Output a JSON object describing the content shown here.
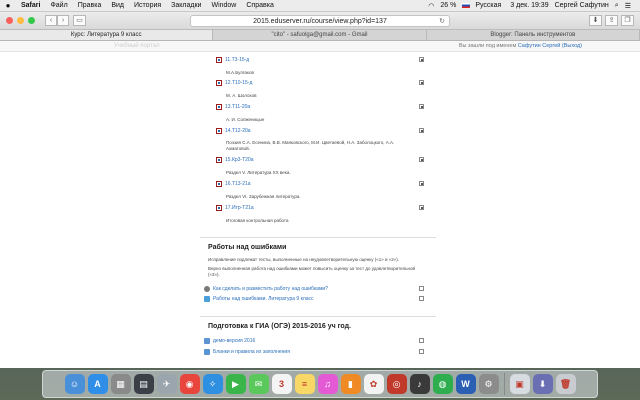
{
  "menubar": {
    "items": [
      "Safari",
      "Файл",
      "Правка",
      "Вид",
      "История",
      "Закладки",
      "Window",
      "Справка"
    ],
    "battery": "26 %",
    "language": "Русская",
    "datetime": "3 дек.  19:39",
    "user": "Сергей Сафутин"
  },
  "browser": {
    "url": "2015.eduserver.ru/course/view.php?id=137",
    "tabs": [
      "Курс: Литература 9 класс",
      "\"cito\" - safuolga@gmail.com - Gmail",
      "Blogger: Панель инструментов"
    ],
    "active_tab": 0
  },
  "site": {
    "brand": "Учебный портал",
    "login_prefix": "Вы зашли под именем",
    "login_user": "Сафутин Сергей",
    "logout": "(Выход)"
  },
  "course_items": [
    {
      "link": "11.Т3-15-д",
      "desc": "М.А.Булгаков",
      "checked": true
    },
    {
      "link": "12.Т10-15-д",
      "desc": "М. А. Шолохов",
      "checked": true
    },
    {
      "link": "13.Т11-20а",
      "desc": "А. И. Солженицын",
      "checked": true
    },
    {
      "link": "14.Т12-20а",
      "desc": "Поэзия С.А. Есенина, В.В. Маяковского, М.И. Цветаевой, Н.А. Заболоцкого, А.А. Ахматовой.",
      "checked": true
    },
    {
      "link": "15.Кр3-Т20а",
      "desc": "Раздел V.  Литература XX века.",
      "checked": true
    },
    {
      "link": "16.Т13-21а",
      "desc": "Раздел  VI.  Зарубежная литература.",
      "checked": true
    },
    {
      "link": "17.Итр-Т21а",
      "desc": "Итоговая контрольная работа",
      "checked": true
    }
  ],
  "section_errors": {
    "title": "Работы над ошибками",
    "text1": "Исправление подлежат тесты, выполненные на неудовлетворительную оценку («1» и «2»).",
    "text2": "Верно выполненная работа над ошибками может повысить оценку за тест до удовлетворительной («3»).",
    "items": [
      {
        "link": "Как сделать и разместить работу над ошибками?",
        "checked": false
      },
      {
        "link": "Работы над ошибками. Литература 9 класс",
        "checked": false
      }
    ]
  },
  "section_gia": {
    "title": "Подготовка к ГИА (ОГЭ) 2015-2016 уч год.",
    "items": [
      {
        "link": "демо-версия 2016",
        "checked": false
      },
      {
        "link": "Бланки и правила их заполнения",
        "checked": false
      }
    ]
  },
  "dock": {
    "apps": [
      {
        "name": "finder",
        "color": "#4a90d9",
        "glyph": "☺"
      },
      {
        "name": "app-store",
        "color": "#2e8ee8",
        "glyph": "A"
      },
      {
        "name": "launchpad",
        "color": "#8a8a8a",
        "glyph": "▦"
      },
      {
        "name": "mission-control",
        "color": "#3a3f48",
        "glyph": "▤"
      },
      {
        "name": "system-utility",
        "color": "#9aa5ad",
        "glyph": "✈"
      },
      {
        "name": "chrome",
        "color": "#e8453c",
        "glyph": "◉"
      },
      {
        "name": "safari",
        "color": "#2f8fe0",
        "glyph": "✧"
      },
      {
        "name": "facetime",
        "color": "#3ab54a",
        "glyph": "▶"
      },
      {
        "name": "messages",
        "color": "#5ac85a",
        "glyph": "✉"
      },
      {
        "name": "calendar",
        "color": "#f4f4f4",
        "glyph": "3"
      },
      {
        "name": "notes",
        "color": "#f7d766",
        "glyph": "≡"
      },
      {
        "name": "itunes",
        "color": "#e45ad4",
        "glyph": "♫"
      },
      {
        "name": "ibooks",
        "color": "#f08a24",
        "glyph": "▮"
      },
      {
        "name": "photos",
        "color": "#f2f2f2",
        "glyph": "✿"
      },
      {
        "name": "photo-booth",
        "color": "#c0392b",
        "glyph": "◎"
      },
      {
        "name": "radio-app",
        "color": "#3a3a3a",
        "glyph": "♪"
      },
      {
        "name": "wifi-app",
        "color": "#2fae4f",
        "glyph": "◍"
      },
      {
        "name": "word",
        "color": "#2b5fb3",
        "glyph": "W"
      },
      {
        "name": "system-preferences",
        "color": "#8c8c8c",
        "glyph": "⚙"
      },
      {
        "name": "preview",
        "color": "#d7dce2",
        "glyph": "▣"
      },
      {
        "name": "downloads",
        "color": "#6a6fb4",
        "glyph": "⬇"
      },
      {
        "name": "trash",
        "color": "#c8ccd0",
        "glyph": "🗑"
      }
    ]
  }
}
